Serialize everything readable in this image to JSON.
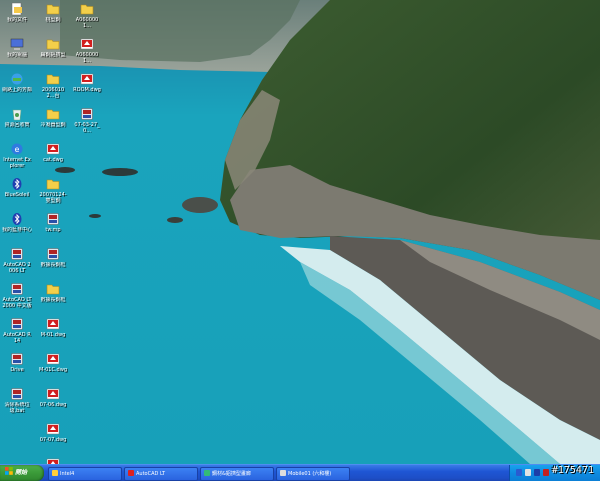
{
  "desktop": {
    "icons": [
      {
        "label": "我的文件",
        "kind": "doc-icon"
      },
      {
        "label": "我的電腦",
        "kind": "computer-icon"
      },
      {
        "label": "網路上的芳鄰",
        "kind": "network-icon"
      },
      {
        "label": "資源回收筒",
        "kind": "recycle-icon"
      },
      {
        "label": "Internet Explorer",
        "kind": "ie-icon"
      },
      {
        "label": "BlueSoleil",
        "kind": "bluetooth-icon"
      },
      {
        "label": "我的藍芽中心",
        "kind": "bluetooth-icon"
      },
      {
        "label": "AutoCAD 2006 LT",
        "kind": "app-icon"
      },
      {
        "label": "AutoCAD LT 2000 中文版",
        "kind": "app-icon"
      },
      {
        "label": "AutoCAD R14",
        "kind": "app-icon"
      },
      {
        "label": "Drive",
        "kind": "app-icon"
      },
      {
        "label": "清除系統垃圾.bat",
        "kind": "app-icon"
      },
      {
        "label": "桃型鋼",
        "kind": "folder-icon"
      },
      {
        "label": "扁鋼鋁擠型",
        "kind": "folder-icon"
      },
      {
        "label": "20060102...台",
        "kind": "folder-icon"
      },
      {
        "label": "冷凝器型鋼",
        "kind": "folder-icon"
      },
      {
        "label": "cat.dwg",
        "kind": "dwg-icon"
      },
      {
        "label": "20070124-雙型鋼",
        "kind": "folder-icon"
      },
      {
        "label": "tw.mp",
        "kind": "app-icon"
      },
      {
        "label": "數據長鋼框",
        "kind": "app-icon"
      },
      {
        "label": "數據長鋼框",
        "kind": "folder-icon"
      },
      {
        "label": "M-01.dwg",
        "kind": "dwg-icon"
      },
      {
        "label": "M-01C.dwg",
        "kind": "dwg-icon"
      },
      {
        "label": "07-06.dwg",
        "kind": "dwg-icon"
      },
      {
        "label": "07-07.dwg",
        "kind": "dwg-icon"
      },
      {
        "label": "07-01.dwg",
        "kind": "dwg-icon"
      },
      {
        "label": "A0600001...",
        "kind": "folder-icon"
      },
      {
        "label": "A0600001...",
        "kind": "dwg-icon"
      },
      {
        "label": "ROOM.dwg",
        "kind": "dwg-icon"
      },
      {
        "label": "07-03-27_0...",
        "kind": "app-icon"
      }
    ]
  },
  "taskbar": {
    "start_label": "開始",
    "tasks": [
      {
        "label": "Intel4"
      },
      {
        "label": "AutoCAD LT"
      },
      {
        "label": "鋼材&鋁擠型畫廊"
      },
      {
        "label": "Mobile01 (六和樓)"
      }
    ]
  },
  "watermark": "#175471",
  "colors": {
    "taskbar": "#1f56d4",
    "start": "#3b9a39",
    "tray": "#0f8be0",
    "sea": "#1aa4bd"
  }
}
